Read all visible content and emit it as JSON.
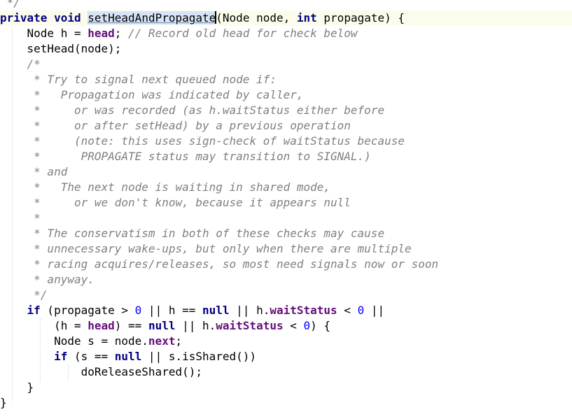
{
  "editor": {
    "comment_close": " */",
    "signature": {
      "private": "private",
      "void": "void",
      "method_name": "setHeadAndPropagate",
      "params_open": "(Node node, ",
      "int": "int",
      "params_close": " propagate) {"
    },
    "line2": {
      "a": "    Node h = ",
      "head": "head",
      "b": "; ",
      "comment": "// Record old head for check below"
    },
    "line3": "    setHead(node);",
    "comment_lines": [
      "    /*",
      "     * Try to signal next queued node if:",
      "     *   Propagation was indicated by caller,",
      "     *     or was recorded (as h.waitStatus either before",
      "     *     or after setHead) by a previous operation",
      "     *     (note: this uses sign-check of waitStatus because",
      "     *      PROPAGATE status may transition to SIGNAL.)",
      "     * and",
      "     *   The next node is waiting in shared mode,",
      "     *     or we don't know, because it appears null",
      "     *",
      "     * The conservatism in both of these checks may cause",
      "     * unnecessary wake-ups, but only when there are multiple",
      "     * racing acquires/releases, so most need signals now or soon",
      "     * anyway.",
      "     */"
    ],
    "if_line1": {
      "indent": "    ",
      "if": "if",
      "a": " (propagate > ",
      "zero": "0",
      "b": " || h == ",
      "null": "null",
      "c": " || h.",
      "waitStatus": "waitStatus",
      "d": " < ",
      "zero2": "0",
      "e": " ||"
    },
    "if_line2": {
      "a": "        (h = ",
      "head": "head",
      "b": ") == ",
      "null": "null",
      "c": " || h.",
      "waitStatus": "waitStatus",
      "d": " < ",
      "zero": "0",
      "e": ") {"
    },
    "node_line": {
      "a": "        Node s = node.",
      "next": "next",
      "b": ";"
    },
    "if_line3": {
      "indent": "        ",
      "if": "if",
      "a": " (s == ",
      "null": "null",
      "b": " || s.isShared())"
    },
    "release_line": "            doReleaseShared();",
    "close_inner": "    }",
    "close_method": "}"
  },
  "colors": {
    "keyword": "#000080",
    "field": "#660e7a",
    "number": "#0000ff",
    "comment": "#808080",
    "selection": "#d7e4f7",
    "current_line": "#fcfcec"
  }
}
